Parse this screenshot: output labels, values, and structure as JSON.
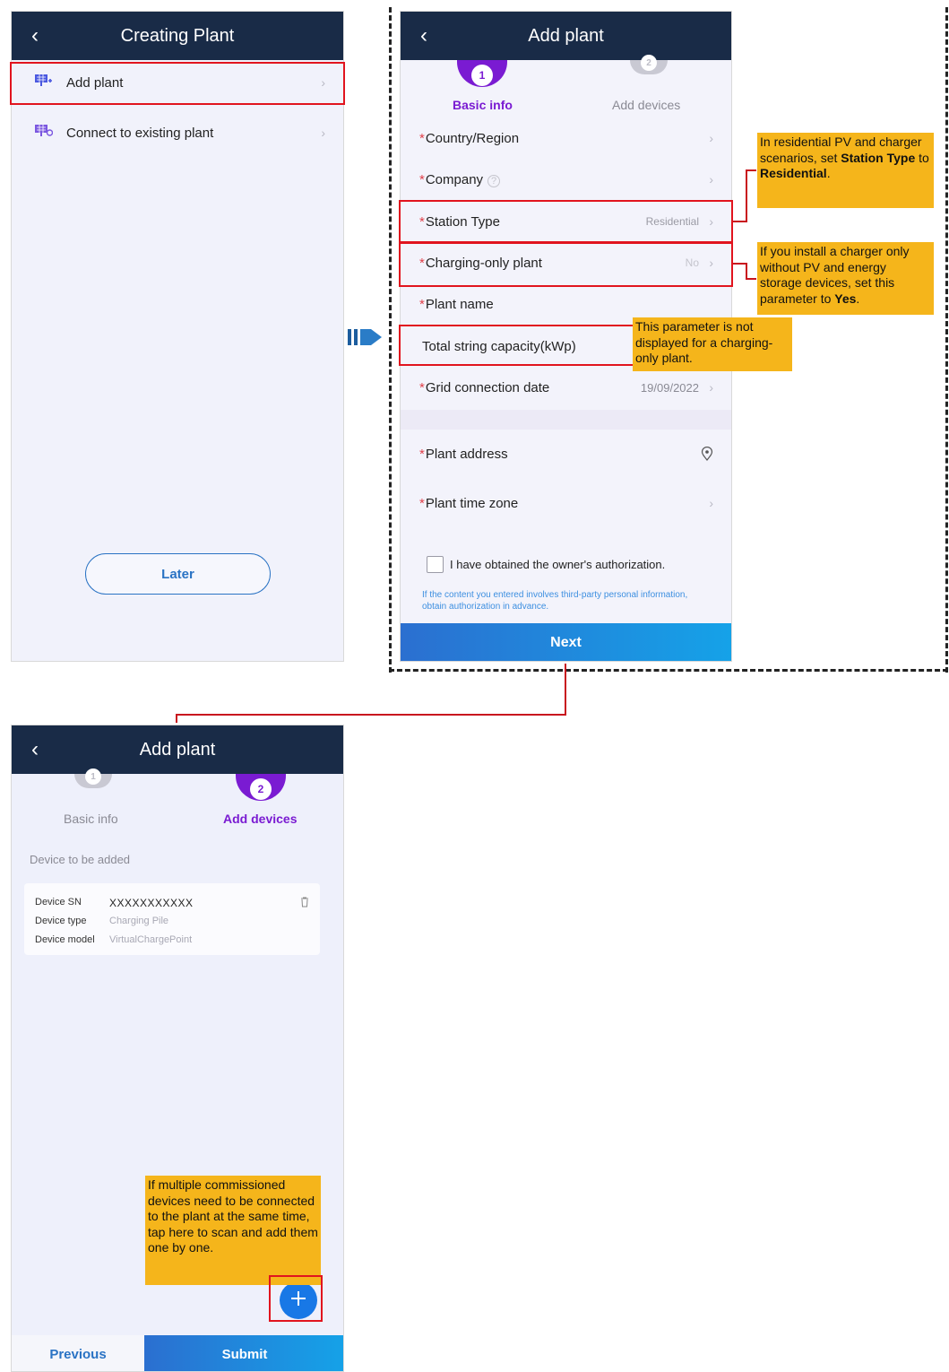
{
  "screen1": {
    "title": "Creating Plant",
    "items": [
      {
        "label": "Add plant"
      },
      {
        "label": "Connect to existing plant"
      }
    ],
    "later_label": "Later"
  },
  "screen2": {
    "title": "Add plant",
    "steps": [
      {
        "number": "1",
        "label": "Basic info"
      },
      {
        "number": "2",
        "label": "Add devices"
      }
    ],
    "fields": {
      "country": "Country/Region",
      "company": "Company",
      "station_type": "Station Type",
      "station_type_value": "Residential",
      "charging_only": "Charging-only plant",
      "charging_only_value": "No",
      "plant_name": "Plant name",
      "total_capacity": "Total string capacity(kWp)",
      "grid_date": "Grid connection date",
      "grid_date_value": "19/09/2022",
      "plant_address": "Plant address",
      "plant_time_zone": "Plant time zone"
    },
    "authorization_label": "I have obtained the owner's authorization.",
    "privacy_note": "If the content you entered involves third-party personal information, obtain authorization in advance.",
    "next_label": "Next"
  },
  "screen3": {
    "title": "Add plant",
    "steps": [
      {
        "number": "1",
        "label": "Basic info"
      },
      {
        "number": "2",
        "label": "Add devices"
      }
    ],
    "section_label": "Device to be added",
    "device": {
      "sn_label": "Device SN",
      "sn_value": "XXXXXXXXXXX",
      "type_label": "Device type",
      "type_value": "Charging Pile",
      "model_label": "Device model",
      "model_value": "VirtualChargePoint"
    },
    "add_icon": "plus-icon",
    "previous_label": "Previous",
    "submit_label": "Submit"
  },
  "notes": {
    "station_type": {
      "pre": "In residential PV and charger scenarios, set ",
      "b1": "Station Type",
      "mid": " to ",
      "b2": "Residential",
      "post": "."
    },
    "charging_only": {
      "pre": "If you install a charger only without PV and energy storage devices, set this parameter to ",
      "b1": "Yes",
      "post": "."
    },
    "capacity": "This parameter is not displayed for a charging-only plant.",
    "multiple": "If multiple commissioned devices need to be connected to the plant at the same time, tap here to scan and add them one by one."
  },
  "colors": {
    "header": "#192b47",
    "accent_purple": "#7a1bd2",
    "next_blue": "#1a7fd6",
    "callout": "#f5b51b",
    "highlight_red": "#e1141e"
  }
}
